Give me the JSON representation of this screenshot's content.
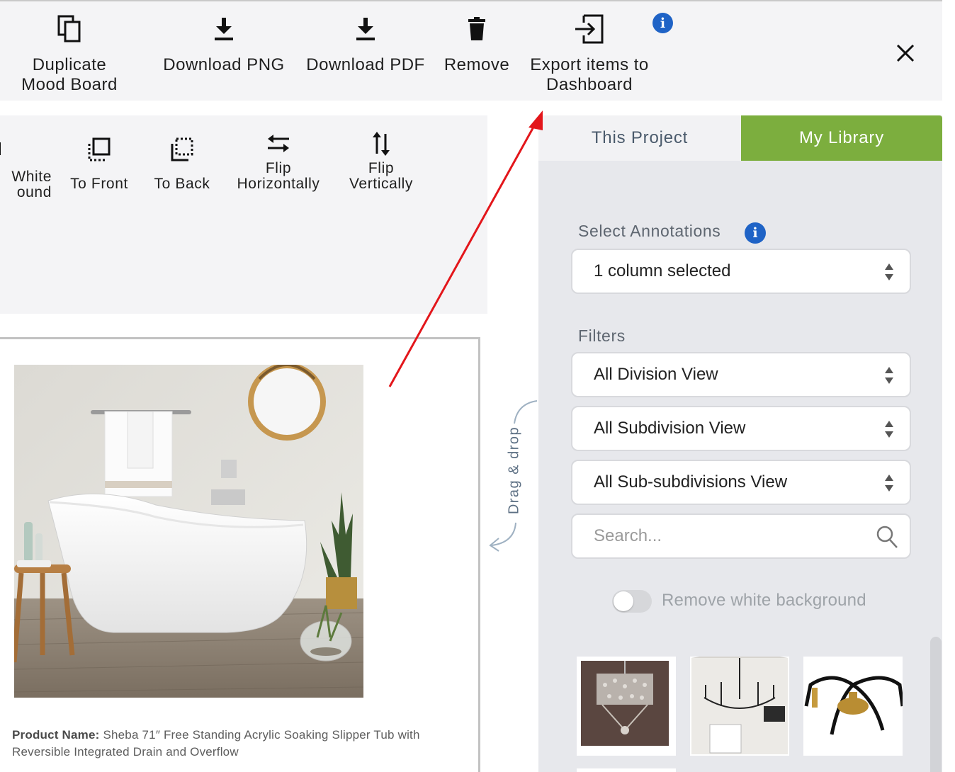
{
  "toolbar": {
    "duplicate_label": "Duplicate Mood Board",
    "download_png_label": "Download PNG",
    "download_pdf_label": "Download PDF",
    "remove_label": "Remove",
    "export_label": "Export items to Dashboard",
    "info_glyph": "i",
    "close_icon": "close-icon"
  },
  "tools": {
    "white_background_label": "White\nound",
    "to_front_label": "To Front",
    "to_back_label": "To Back",
    "flip_h_label": "Flip\nHorizontally",
    "flip_v_label": "Flip\nVertically"
  },
  "canvas": {
    "caption_prefix": "Product Name:",
    "caption_text": " Sheba 71″ Free Standing Acrylic Soaking Slipper Tub with Reversible Integrated Drain and Overflow",
    "drag_hint": "Drag & drop"
  },
  "panel": {
    "tabs": [
      {
        "label": "This Project",
        "active": false
      },
      {
        "label": "My Library",
        "active": true
      }
    ],
    "annotations_label": "Select Annotations",
    "annotations_value": "1 column selected",
    "filters_label": "Filters",
    "filters": [
      {
        "value": "All Division View"
      },
      {
        "value": "All Subdivision View"
      },
      {
        "value": "All Sub-subdivisions View"
      }
    ],
    "search_placeholder": "Search...",
    "remove_bg_label": "Remove white background",
    "remove_bg_on": false,
    "thumbnails": [
      {
        "name": "crystal-chandelier"
      },
      {
        "name": "black-iron-chandelier"
      },
      {
        "name": "brass-black-chandelier"
      }
    ]
  },
  "colors": {
    "accent_green": "#7cae3e",
    "info_blue": "#1f63c6",
    "annotation_red": "#e3161b"
  }
}
